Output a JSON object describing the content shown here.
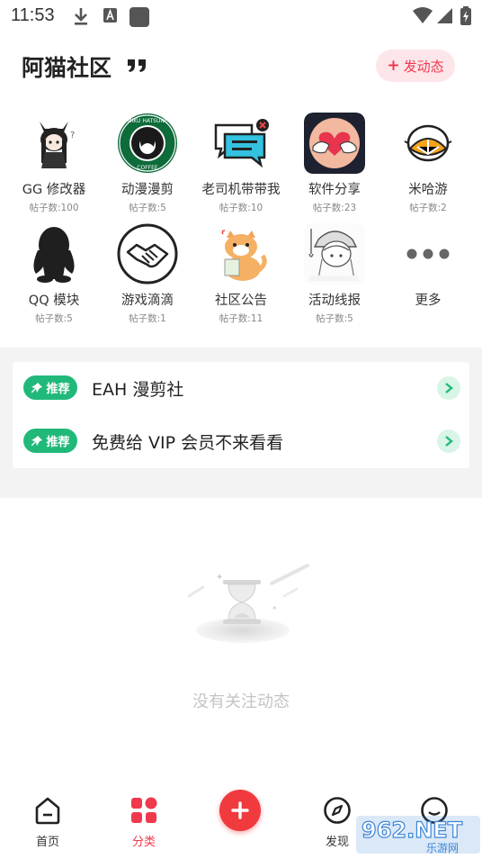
{
  "status_bar": {
    "time": "11:53"
  },
  "header": {
    "title": "阿猫社区",
    "post_button": "发动态"
  },
  "categories": [
    {
      "name": "GG 修改器",
      "count": "帖子数:100",
      "icon": "anime-catgirl-icon"
    },
    {
      "name": "动漫漫剪",
      "count": "帖子数:5",
      "icon": "miku-coffee-badge-icon"
    },
    {
      "name": "老司机带带我",
      "count": "帖子数:10",
      "icon": "chat-bubbles-icon"
    },
    {
      "name": "软件分享",
      "count": "帖子数:23",
      "icon": "heart-hands-icon"
    },
    {
      "name": "米哈游",
      "count": "帖子数:2",
      "icon": "lemon-icon"
    },
    {
      "name": "QQ 模块",
      "count": "帖子数:5",
      "icon": "qq-penguin-icon"
    },
    {
      "name": "游戏滴滴",
      "count": "帖子数:1",
      "icon": "handshake-icon"
    },
    {
      "name": "社区公告",
      "count": "帖子数:11",
      "icon": "cat-cartoon-icon"
    },
    {
      "name": "活动线报",
      "count": "帖子数:5",
      "icon": "anime-girl-sketch-icon"
    },
    {
      "name": "更多",
      "count": "",
      "icon": "more-dots-icon"
    }
  ],
  "recommend": {
    "tag_label": "推荐",
    "items": [
      {
        "text": "EAH 漫剪社"
      },
      {
        "text": "免费给 VIP 会员不来看看"
      }
    ]
  },
  "empty_state": {
    "text": "没有关注动态"
  },
  "bottom_nav": {
    "items": [
      {
        "label": "首页",
        "icon": "home-icon"
      },
      {
        "label": "分类",
        "icon": "category-grid-icon"
      },
      {
        "label": "发现",
        "icon": "compass-icon"
      },
      {
        "label": "",
        "icon": "profile-icon"
      }
    ]
  },
  "watermark": {
    "text": "962.NET",
    "subtext": "乐游网"
  },
  "colors": {
    "accent": "#f0394d",
    "recommend_tag": "#21b97a",
    "post_button_bg": "#fde6ea",
    "section_bg": "#f3f3f3"
  }
}
